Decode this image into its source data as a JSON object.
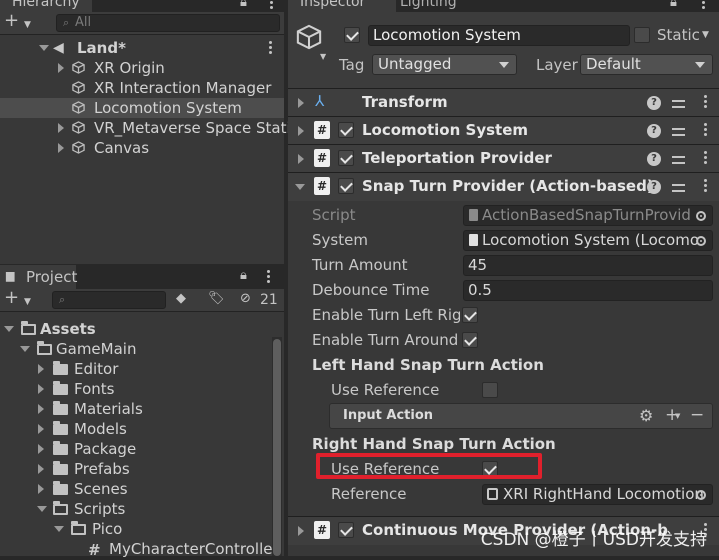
{
  "hierarchy": {
    "tab_label": "Hierarchy",
    "search_placeholder": "All",
    "scene": "Land*",
    "items": [
      {
        "label": "XR Origin"
      },
      {
        "label": "XR Interaction Manager"
      },
      {
        "label": "Locomotion System"
      },
      {
        "label": "VR_Metaverse Space Stati"
      },
      {
        "label": "Canvas"
      }
    ]
  },
  "project": {
    "tab_label": "Project",
    "hidden_count": "21",
    "tree": {
      "assets": "Assets",
      "gamemain": "GameMain",
      "folders": [
        "Editor",
        "Fonts",
        "Materials",
        "Models",
        "Package",
        "Prefabs",
        "Scenes"
      ],
      "scripts": "Scripts",
      "pico": "Pico",
      "file": "MyCharacterControlle"
    }
  },
  "inspector": {
    "tab_label": "Inspector",
    "lighting_tab_label": "Lighting",
    "object_name": "Locomotion System",
    "static_label": "Static",
    "tag_label": "Tag",
    "tag_value": "Untagged",
    "layer_label": "Layer",
    "layer_value": "Default",
    "components": {
      "transform": "Transform",
      "locomotion": "Locomotion System",
      "teleport": "Teleportation Provider",
      "snap": "Snap Turn Provider (Action-based)",
      "continuous": "Continuous Move Provider (Action-b"
    },
    "snap_props": {
      "script_label": "Script",
      "script_value": "ActionBasedSnapTurnProvid",
      "system_label": "System",
      "system_value": "Locomotion System (Locomo",
      "turn_amount_label": "Turn Amount",
      "turn_amount_value": "45",
      "debounce_label": "Debounce Time",
      "debounce_value": "0.5",
      "enable_left_label": "Enable Turn Left Rigl",
      "enable_around_label": "Enable Turn Around",
      "left_section": "Left Hand Snap Turn Action",
      "left_use_ref_label": "Use Reference",
      "input_action_label": "Input Action",
      "right_section": "Right Hand Snap Turn Action",
      "right_use_ref_label": "Use Reference",
      "reference_label": "Reference",
      "reference_value": "XRI RightHand Locomotion"
    }
  },
  "watermark": "CSDN @橙子丨USD开发支持",
  "colors": {
    "highlight": "#e0202c"
  }
}
